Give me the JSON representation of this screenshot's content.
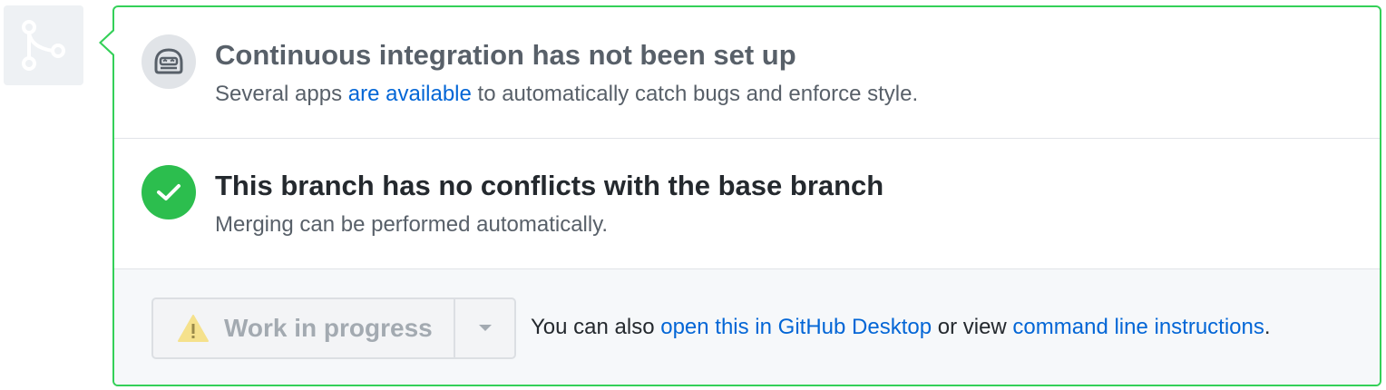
{
  "ci_status": {
    "icon": "bot-icon",
    "title": "Continuous integration has not been set up",
    "desc_before": "Several apps ",
    "desc_link": "are available",
    "desc_after": " to automatically catch bugs and enforce style."
  },
  "conflict_status": {
    "icon": "check-icon",
    "title": "This branch has no conflicts with the base branch",
    "desc": "Merging can be performed automatically."
  },
  "merge_actions": {
    "button_label": "Work in progress",
    "button_icon": "warning-icon",
    "dropdown_icon": "caret-down-icon",
    "text_before": "You can also ",
    "desktop_link": "open this in GitHub Desktop",
    "text_middle": " or view ",
    "cli_link": "command line instructions",
    "text_after": "."
  },
  "colors": {
    "success_green": "#2cbe4e",
    "border_green": "#34d058",
    "link_blue": "#0366d6",
    "warning_yellow": "#f5e18c"
  }
}
